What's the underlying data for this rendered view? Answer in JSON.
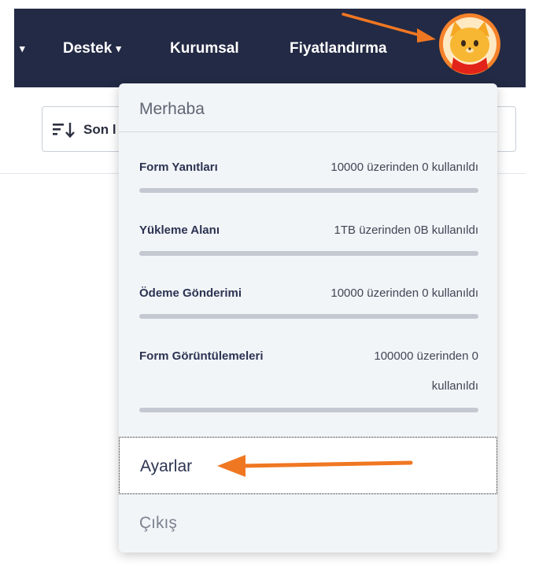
{
  "nav": {
    "partial_caret": "▾",
    "support": "Destek",
    "support_caret": "▾",
    "corporate": "Kurumsal",
    "pricing": "Fiyatlandırma"
  },
  "toolbar": {
    "sort_label": "Son l"
  },
  "dropdown": {
    "greeting": "Merhaba",
    "usage": [
      {
        "label": "Form Yanıtları",
        "value": "10000 üzerinden 0 kullanıldı",
        "fraction": 0
      },
      {
        "label": "Yükleme Alanı",
        "value": "1TB üzerinden 0B kullanıldı",
        "fraction": 0
      },
      {
        "label": "Ödeme Gönderimi",
        "value": "10000 üzerinden 0 kullanıldı",
        "fraction": 0
      },
      {
        "label": "Form Görüntülemeleri",
        "value_line1": "100000 üzerinden 0",
        "value_line2": "kullanıldı",
        "fraction": 0
      }
    ],
    "settings": "Ayarlar",
    "logout": "Çıkış"
  },
  "colors": {
    "topbar": "#232a45",
    "annotation_arrow": "#f07722",
    "avatar": "#f5822a",
    "menu_bg": "#f2f5f8"
  },
  "icons": {
    "avatar": "cat-mascot-avatar",
    "sort": "sort-descending-icon"
  }
}
